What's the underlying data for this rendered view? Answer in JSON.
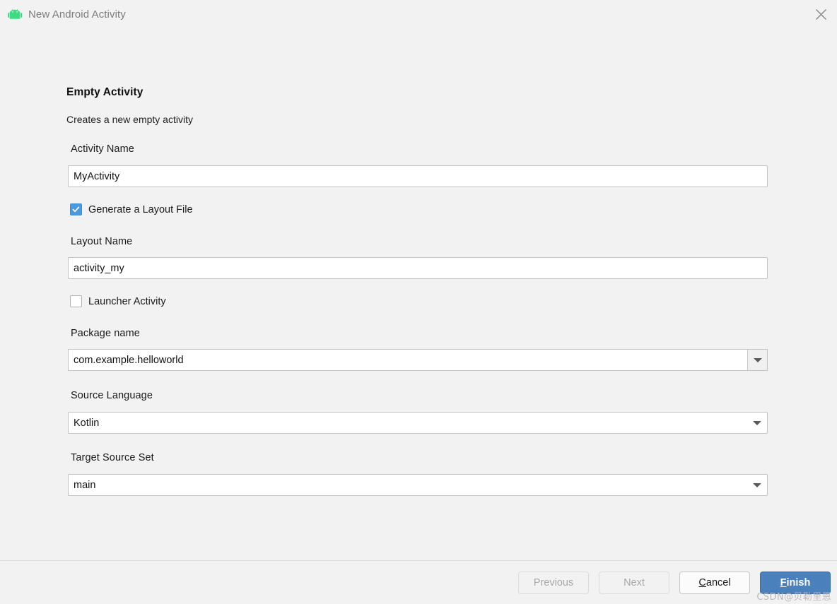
{
  "window": {
    "title": "New Android Activity",
    "icon": "android-robot-icon",
    "close_icon": "close-icon",
    "background": "#f2f2f2"
  },
  "main": {
    "heading": "Empty Activity",
    "subheading": "Creates a new empty activity",
    "fields": {
      "activity_name": {
        "label": "Activity Name",
        "value": "MyActivity",
        "placeholder": ""
      },
      "generate_layout_file": {
        "label": "Generate a Layout File",
        "checked": true
      },
      "layout_name": {
        "label": "Layout Name",
        "value": "activity_my",
        "placeholder": ""
      },
      "launcher_activity": {
        "label": "Launcher Activity",
        "checked": false
      },
      "package_name": {
        "label": "Package name",
        "value": "com.example.helloworld",
        "dropdown_icon": "chevron-down-icon"
      },
      "source_language": {
        "label": "Source Language",
        "value": "Kotlin",
        "dropdown_icon": "chevron-down-icon"
      },
      "target_source_set": {
        "label": "Target Source Set",
        "value": "main",
        "dropdown_icon": "chevron-down-icon"
      }
    }
  },
  "footer": {
    "previous": {
      "label": "Previous",
      "enabled": false
    },
    "next": {
      "label": "Next",
      "enabled": false
    },
    "cancel": {
      "mnemonic": "C",
      "rest": "ancel"
    },
    "finish": {
      "mnemonic": "F",
      "rest": "inish"
    }
  },
  "watermark": "CSDN@贝勒里恩",
  "colors": {
    "accent_blue": "#4a81bd",
    "checkbox_blue": "#4a9ae0",
    "android_green": "#3ddc84",
    "dialog_bg": "#f2f2f2",
    "field_bg": "#ffffff",
    "field_border": "#c4c4c4"
  }
}
